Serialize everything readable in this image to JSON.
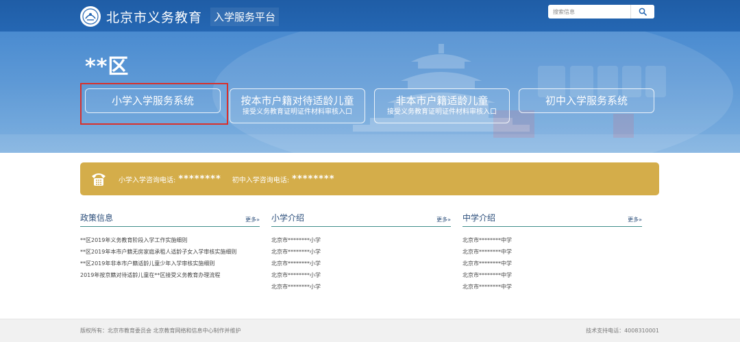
{
  "header": {
    "site_name": "北京市义务教育",
    "site_sub": "入学服务平台",
    "logo_icon": "education-emblem-icon",
    "search": {
      "placeholder": "搜索信息",
      "icon": "search-icon"
    }
  },
  "banner": {
    "district": "**区",
    "buttons": [
      {
        "main": "小学入学服务系统",
        "sub": ""
      },
      {
        "main": "按本市户籍对待适龄儿童",
        "sub": "接受义务教育证明证件材料审核入口"
      },
      {
        "main": "非本市户籍适龄儿童",
        "sub": "接受义务教育证明证件材料审核入口"
      },
      {
        "main": "初中入学服务系统",
        "sub": ""
      }
    ],
    "highlight_color": "#d9302b"
  },
  "phone_bar": {
    "icon": "telephone-icon",
    "primary_label": "小学入学咨询电话:",
    "primary_value": "********",
    "middle_label": "初中入学咨询电话:",
    "middle_value": "********",
    "color": "#d4ad4a"
  },
  "columns": {
    "policy": {
      "title": "政策信息",
      "more": "更多»",
      "items": [
        "**区2019年义务教育阶段入学工作实施细则",
        "**区2019年本市户籍无房家庭承租人适龄子女入学审核实施细则",
        "**区2019年非本市户籍适龄儿童少年入学审核实施细则",
        "2019年按京籍对待适龄儿童在**区接受义务教育办理流程"
      ]
    },
    "primary": {
      "title": "小学介绍",
      "more": "更多»",
      "items": [
        "北京市********小学",
        "北京市********小学",
        "北京市********小学",
        "北京市********小学",
        "北京市********小学"
      ]
    },
    "middle": {
      "title": "中学介绍",
      "more": "更多»",
      "items": [
        "北京市********中学",
        "北京市********中学",
        "北京市********中学",
        "北京市********中学",
        "北京市********中学"
      ]
    }
  },
  "footer": {
    "copyright": "版权所有：北京市教育委员会 北京教育网络和信息中心制作并维护",
    "support": "技术支持电话：4008310001"
  },
  "colors": {
    "header": "#2567b3",
    "accent_line": "#3f8e8a",
    "link_text": "#2a4d7a"
  }
}
